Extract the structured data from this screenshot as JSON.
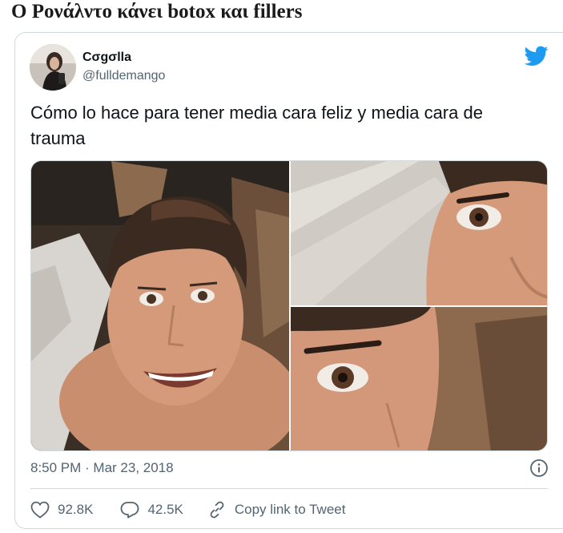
{
  "article": {
    "headline": "Ο Ρονάλντο κάνει botox και fillers"
  },
  "tweet": {
    "user": {
      "display_name": "Cσgσlla",
      "handle": "@fulldemango"
    },
    "text": "Cómo lo hace para tener media cara feliz y media cara de trauma",
    "timestamp": "8:50 PM · Mar 23, 2018",
    "likes": "92.8K",
    "replies": "42.5K",
    "copy_link_label": "Copy link to Tweet"
  },
  "colors": {
    "brand": "#1d9bf0",
    "text_primary": "#0f1419",
    "text_secondary": "#536471",
    "border": "#cfd9de"
  },
  "icons": {
    "brand": "twitter-bird-icon",
    "info": "info-icon",
    "like": "heart-icon",
    "reply": "reply-icon",
    "link": "link-icon"
  }
}
